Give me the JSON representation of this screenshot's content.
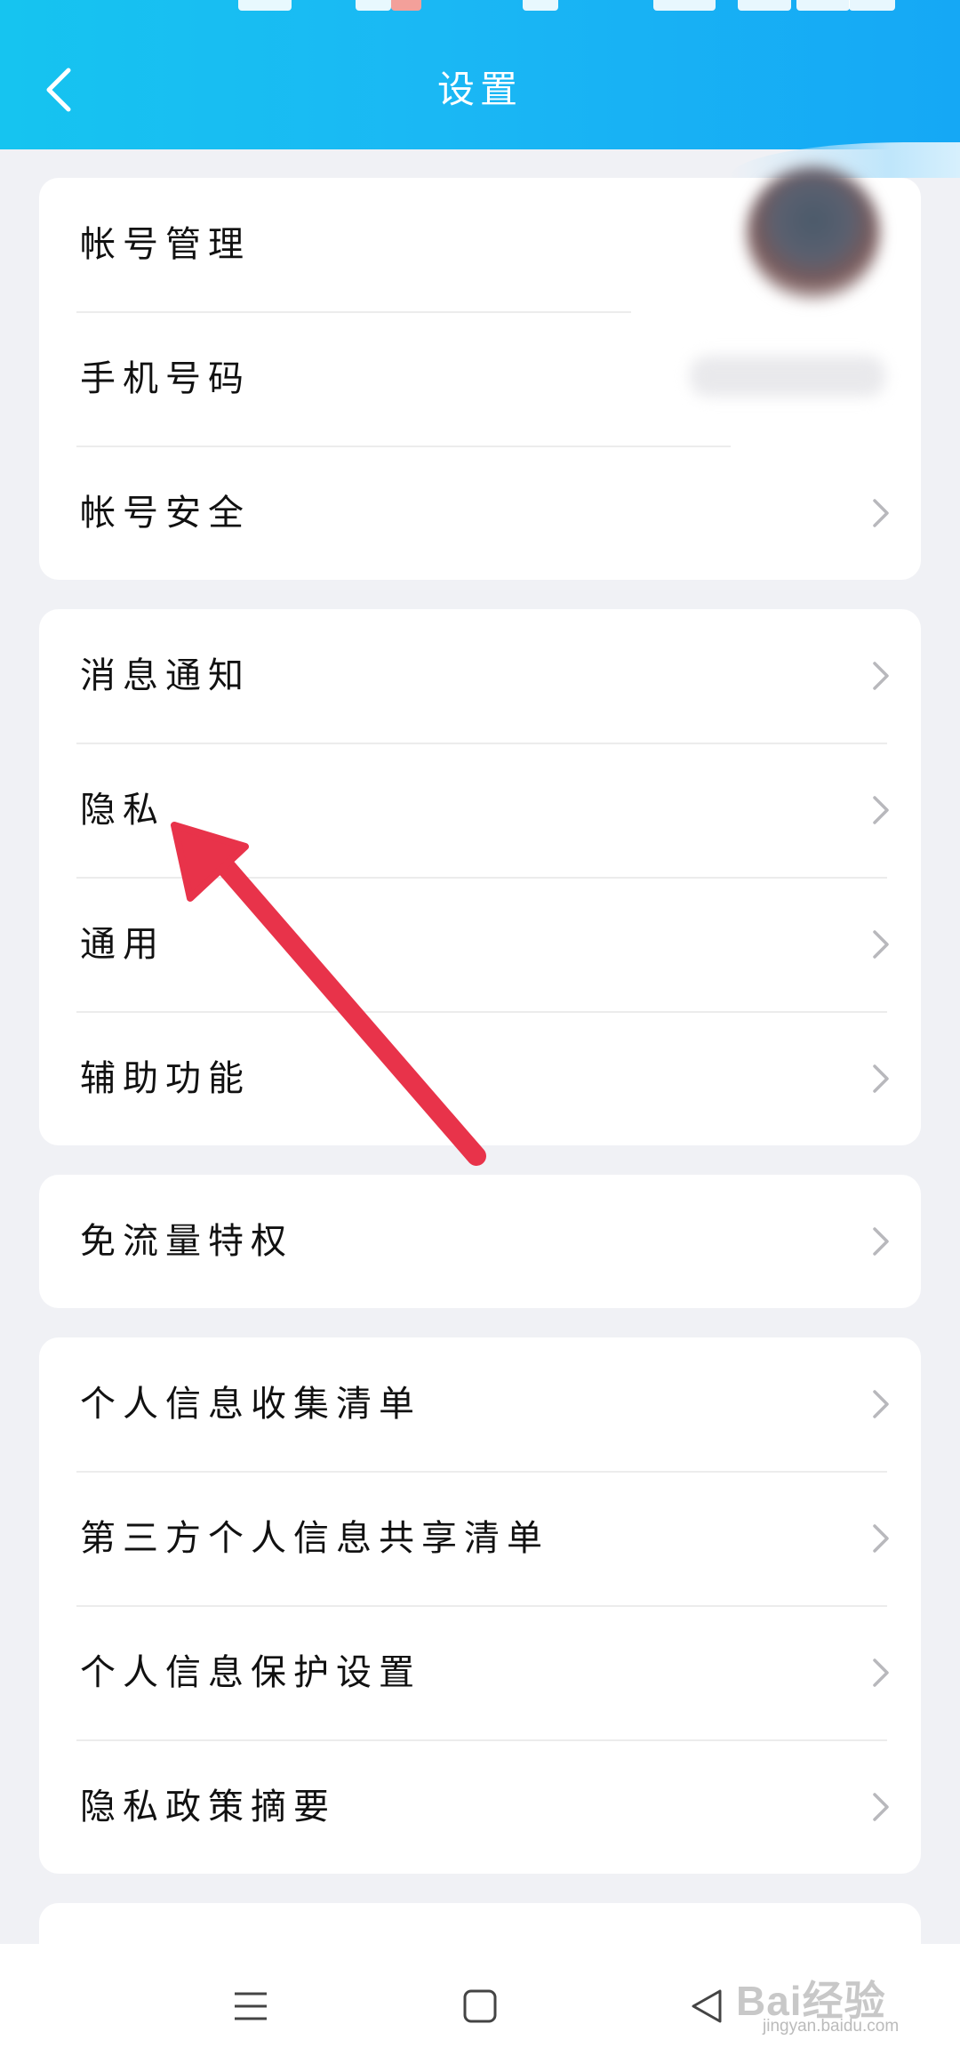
{
  "header": {
    "title": "设置",
    "back_icon": "chevron-left-icon",
    "background": "#16c4f0"
  },
  "groups": [
    {
      "items": [
        {
          "label": "帐号管理",
          "chevron": false
        },
        {
          "label": "手机号码",
          "chevron": false
        },
        {
          "label": "帐号安全",
          "chevron": true
        }
      ]
    },
    {
      "items": [
        {
          "label": "消息通知",
          "chevron": true
        },
        {
          "label": "隐私",
          "chevron": true
        },
        {
          "label": "通用",
          "chevron": true
        },
        {
          "label": "辅助功能",
          "chevron": true
        }
      ]
    },
    {
      "items": [
        {
          "label": "免流量特权",
          "chevron": true
        }
      ]
    },
    {
      "items": [
        {
          "label": "个人信息收集清单",
          "chevron": true
        },
        {
          "label": "第三方个人信息共享清单",
          "chevron": true
        },
        {
          "label": "个人信息保护设置",
          "chevron": true
        },
        {
          "label": "隐私政策摘要",
          "chevron": true
        }
      ]
    }
  ],
  "annotation": {
    "type": "arrow",
    "color": "#e8334a",
    "points_to": "隐私"
  },
  "navbar": {
    "icons": [
      "menu-icon",
      "home-square-icon",
      "back-triangle-icon"
    ]
  },
  "watermark": {
    "logo": "Bai经验",
    "url": "jingyan.baidu.com"
  },
  "colors": {
    "chevron": "#b8b8bc",
    "divider": "#ececec",
    "page_bg": "#f0f1f5"
  }
}
